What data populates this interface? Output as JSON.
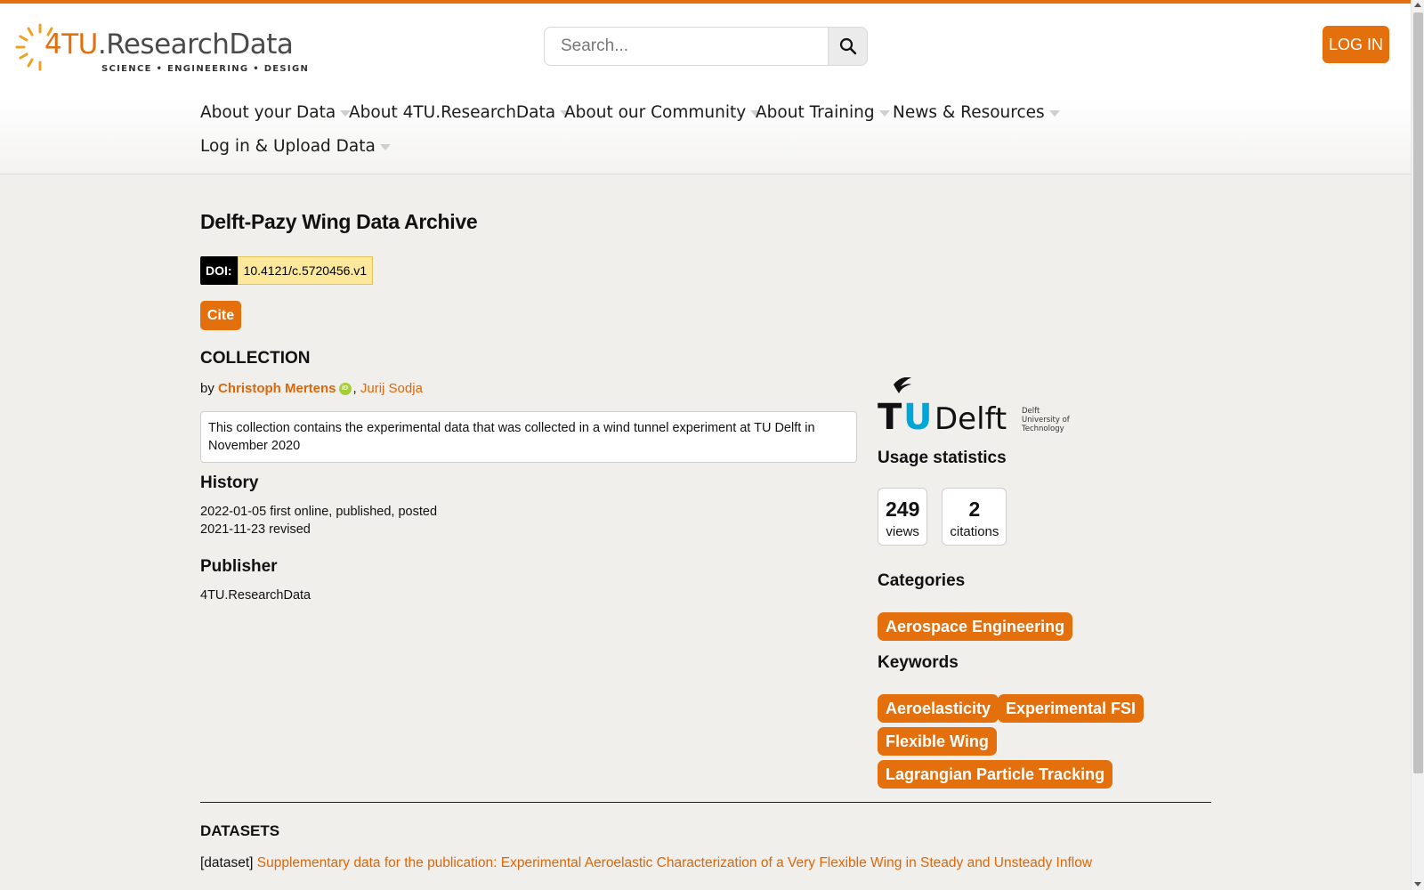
{
  "brand": {
    "logo_prefix": "4TU",
    "logo_suffix": ".ResearchData",
    "tagline": "SCIENCE • ENGINEERING • DESIGN",
    "accent_color": "#e36f0d"
  },
  "search": {
    "placeholder": "Search...",
    "value": "",
    "icon": "search-icon"
  },
  "header": {
    "login_label": "LOG IN"
  },
  "nav": [
    {
      "label": "About your Data"
    },
    {
      "label": "About 4TU.ResearchData"
    },
    {
      "label": "About our Community"
    },
    {
      "label": "About Training"
    },
    {
      "label": "News & Resources"
    },
    {
      "label": "Log in & Upload Data"
    }
  ],
  "record": {
    "title": "Delft-Pazy Wing Data Archive",
    "doi_label": "DOI:",
    "doi": "10.4121/c.5720456.v1",
    "cite_label": "Cite",
    "kind": "COLLECTION",
    "by": "by",
    "authors": [
      "Christoph Mertens",
      "Jurij Sodja"
    ],
    "author_sep": ",",
    "description": "This collection contains the experimental data that was collected in a wind tunnel experiment at TU Delft in November 2020",
    "history_heading": "History",
    "history": [
      "2022-01-05 first online, published, posted",
      "2021-11-23 revised"
    ],
    "publisher_heading": "Publisher",
    "publisher": "4TU.ResearchData"
  },
  "sidebar": {
    "institution_logo": {
      "t": "T",
      "u": "U",
      "delft": "Delft",
      "sub1": "Delft",
      "sub2": "University of",
      "sub3": "Technology"
    },
    "usage_heading": "Usage statistics",
    "views_count": "249",
    "views_label": "views",
    "citations_count": "2",
    "citations_label": "citations",
    "categories_heading": "Categories",
    "categories": [
      "Aerospace Engineering"
    ],
    "keywords_heading": "Keywords",
    "keywords": [
      "Aeroelasticity",
      "Experimental FSI",
      "Flexible Wing",
      "Lagrangian Particle Tracking"
    ]
  },
  "datasets": {
    "heading": "DATASETS",
    "items": [
      {
        "prefix": "[dataset]",
        "title": "Supplementary data for the publication: Experimental Aeroelastic Characterization of a Very Flexible Wing in Steady and Unsteady Inflow"
      }
    ]
  }
}
